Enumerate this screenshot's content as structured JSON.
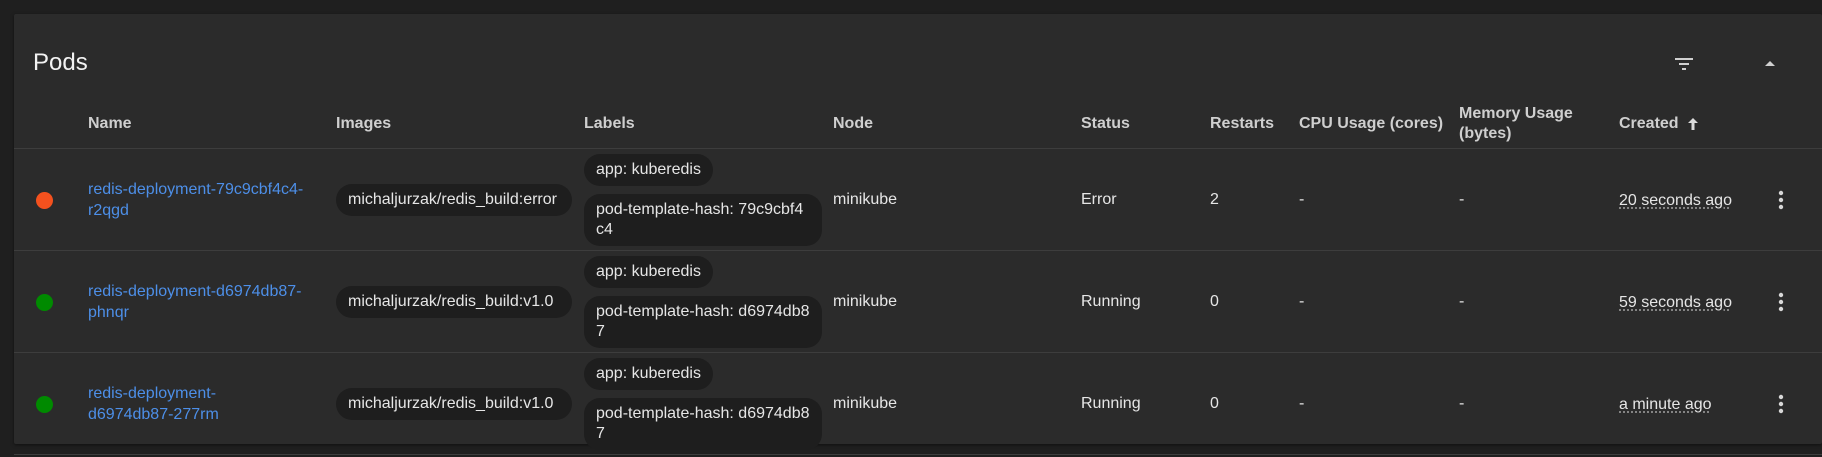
{
  "card": {
    "title": "Pods",
    "icons": {
      "filter": "filter-icon",
      "collapse": "collapse-up-icon"
    }
  },
  "columns": {
    "name": "Name",
    "images": "Images",
    "labels": "Labels",
    "node": "Node",
    "status": "Status",
    "restarts": "Restarts",
    "cpu": "CPU Usage (cores)",
    "memory_line1": "Memory Usage",
    "memory_line2": "(bytes)",
    "created": "Created"
  },
  "colors": {
    "error": "#f4511e",
    "running": "#008a00",
    "link": "#4d8fe8"
  },
  "rows": [
    {
      "status_color": "#f4511e",
      "name": "redis-deployment-79c9cbf4c4-r2qgd",
      "image": "michaljurzak/redis_build:error",
      "labels": [
        "app: kuberedis",
        "pod-template-hash: 79c9cbf4c4"
      ],
      "node": "minikube",
      "status": "Error",
      "restarts": "2",
      "cpu": "-",
      "memory": "-",
      "created": "20 seconds ago"
    },
    {
      "status_color": "#008a00",
      "name": "redis-deployment-d6974db87-phnqr",
      "image": "michaljurzak/redis_build:v1.0",
      "labels": [
        "app: kuberedis",
        "pod-template-hash: d6974db87"
      ],
      "node": "minikube",
      "status": "Running",
      "restarts": "0",
      "cpu": "-",
      "memory": "-",
      "created": "59 seconds ago"
    },
    {
      "status_color": "#008a00",
      "name": "redis-deployment-d6974db87-277rm",
      "image": "michaljurzak/redis_build:v1.0",
      "labels": [
        "app: kuberedis",
        "pod-template-hash: d6974db87"
      ],
      "node": "minikube",
      "status": "Running",
      "restarts": "0",
      "cpu": "-",
      "memory": "-",
      "created": "a minute ago"
    }
  ]
}
